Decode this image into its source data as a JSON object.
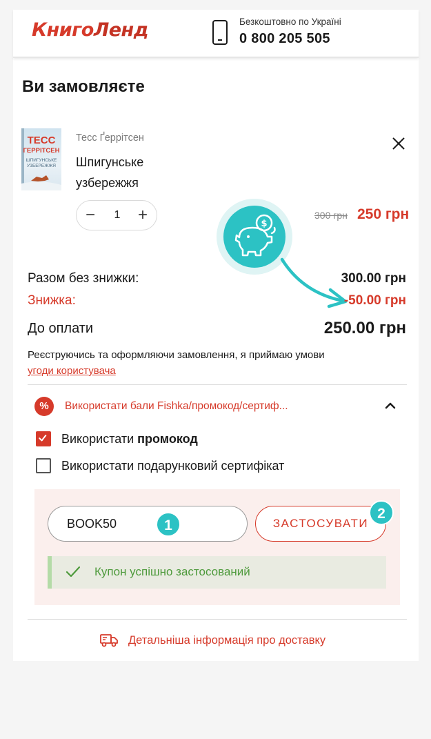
{
  "brand": {
    "logo_part1": "Книго",
    "logo_part2": "Ленд"
  },
  "header": {
    "free_label": "Безкоштовно по Україні",
    "phone": "0 800 205 505"
  },
  "order": {
    "title": "Ви замовляєте",
    "item": {
      "author": "Тесс Ґеррітсен",
      "title": "Шпигунське узбережжя",
      "cover_author": "ТЕСС ГЕРРІТСЕН",
      "cover_title": "ШПИГУНСЬКЕ УЗБЕРЕЖЖЯ",
      "quantity": "1",
      "minus": "−",
      "plus": "+",
      "old_price": "300 грн",
      "price": "250 грн"
    }
  },
  "totals": {
    "subtotal_label": "Разом без знижки:",
    "subtotal_value": "300.00 грн",
    "discount_label": "Знижка:",
    "discount_value": "-50.00 грн",
    "total_label": "До оплати",
    "total_value": "250.00 грн"
  },
  "terms": {
    "text": "Реєструючись та оформляючи замовлення, я приймаю умови",
    "link": "угоди користувача"
  },
  "promo": {
    "toggle_label": "Використати бали Fishka/промокод/сертиф...",
    "percent_symbol": "%",
    "use_promocode_prefix": "Використати ",
    "use_promocode_bold": "промокод",
    "use_promocode_checked": true,
    "use_certificate": "Використати подарунковий сертифікат",
    "use_certificate_checked": false,
    "code_value": "BOOK50",
    "apply_label": "ЗАСТОСУВАТИ",
    "badge1": "1",
    "badge2": "2",
    "success_text": "Купон успішно застосований"
  },
  "delivery": {
    "link": "Детальніша інформація про доставку"
  },
  "colors": {
    "accent": "#d63a2a",
    "teal": "#2cc2c4",
    "success_text": "#4e9a3c",
    "success_bg": "#e9ebe1"
  },
  "icons": [
    "phone-icon",
    "close-icon",
    "piggy-bank-icon",
    "percent-icon",
    "chevron-up-icon",
    "checkmark-icon",
    "truck-icon"
  ]
}
